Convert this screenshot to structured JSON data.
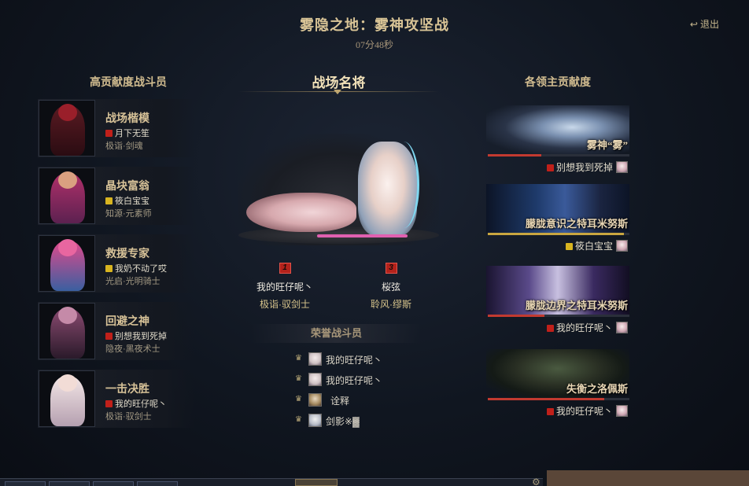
{
  "header": {
    "title": "雾隐之地：雾神攻坚战",
    "timer": "07分48秒",
    "exit_label": "退出"
  },
  "columns": {
    "left_title": "高贡献度战斗员",
    "mid_title": "战场名将",
    "right_title": "各领主贡献度"
  },
  "fighters": [
    {
      "title": "战场楷模",
      "player": "月下无笙",
      "rank_color": "red",
      "class": "极诣·剑魂"
    },
    {
      "title": "晶块富翁",
      "player": "筱白宝宝",
      "rank_color": "gold",
      "class": "知源·元素师"
    },
    {
      "title": "救援专家",
      "player": "我奶不动了哎",
      "rank_color": "gold",
      "class": "光启·光明骑士"
    },
    {
      "title": "回避之神",
      "player": "别想我到死掉",
      "rank_color": "red",
      "class": "隐夜·黑夜术士"
    },
    {
      "title": "一击决胜",
      "player": "我的旺仔呢丶",
      "rank_color": "red",
      "class": "极诣·驭剑士"
    }
  ],
  "mvps": [
    {
      "badge": "1",
      "name": "我的旺仔呢丶",
      "class": "极诣·驭剑士"
    },
    {
      "badge": "3",
      "name": "桜弦",
      "class": "聆风·缪斯"
    }
  ],
  "honor": {
    "title": "荣誉战斗员",
    "members": [
      "我的旺仔呢丶",
      "我的旺仔呢丶",
      "诠释",
      "剑影※▓"
    ]
  },
  "bosses": [
    {
      "name": "雾神“雾”",
      "player": "别想我到死掉",
      "rank_color": "red",
      "bar_color": "#c23a30",
      "progress": 0.38
    },
    {
      "name": "朦胧意识之特耳米努斯",
      "player": "筱白宝宝",
      "rank_color": "gold",
      "bar_color": "#c9a640",
      "progress": 0.96
    },
    {
      "name": "朦胧边界之特耳米努斯",
      "player": "我的旺仔呢丶",
      "rank_color": "red",
      "bar_color": "#c23a30",
      "progress": 0.4
    },
    {
      "name": "失衡之洛佩斯",
      "player": "我的旺仔呢丶",
      "rank_color": "red",
      "bar_color": "#c23a30",
      "progress": 0.82
    }
  ],
  "colors": {
    "accent_gold": "#d9c496",
    "rank_red": "#c0201a",
    "rank_gold": "#d8b420"
  },
  "icons": {
    "exit": "exit-arrow-icon",
    "honor_crown": "crown-icon",
    "settings": "gear-icon"
  }
}
